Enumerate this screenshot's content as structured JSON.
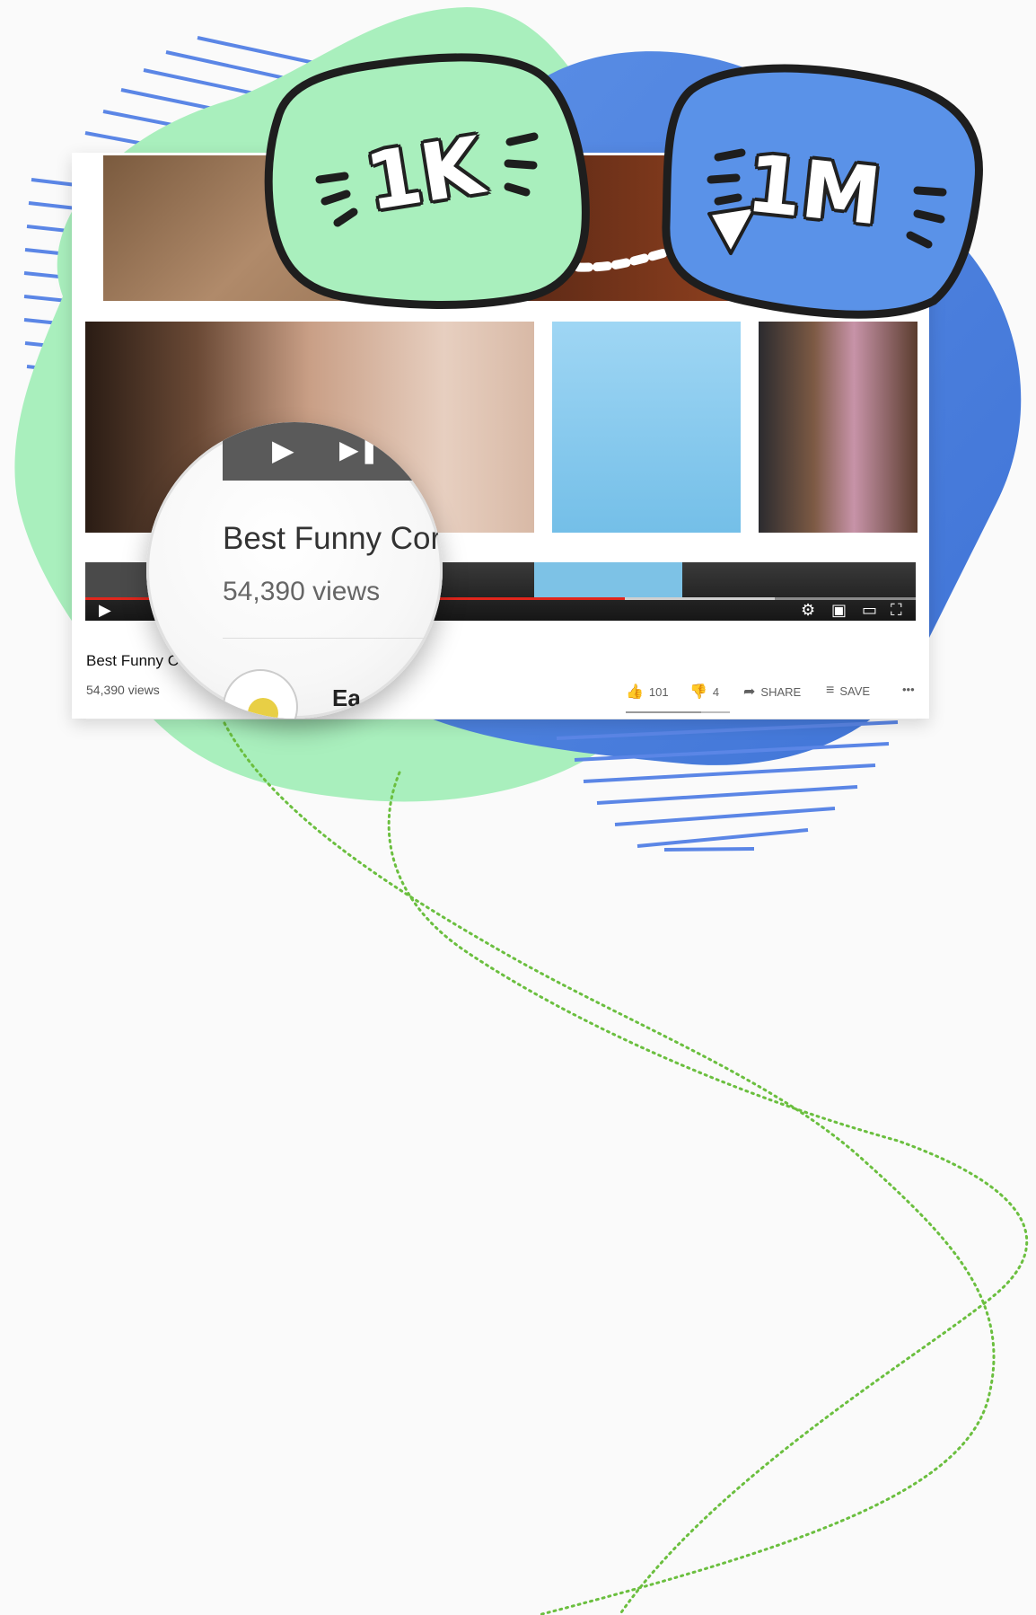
{
  "badges": {
    "from": {
      "label": "1K",
      "color": "#a9efbd"
    },
    "to": {
      "label": "1M",
      "color": "#5a92e8"
    }
  },
  "video": {
    "title": "Best Funny C",
    "views": "54,390 views",
    "progress_percent": 65,
    "buffered_percent": 83,
    "actions": {
      "like_count": "101",
      "dislike_count": "4",
      "share_label": "SHARE",
      "save_label": "SAVE",
      "more_label": "•••"
    },
    "player_controls": {
      "play": "▶",
      "next": "▶|"
    }
  },
  "magnifier": {
    "title": "Best Funny Cor",
    "views": "54,390 views",
    "next_title": "Ea"
  },
  "colors": {
    "accent_green": "#a9efbd",
    "accent_blue": "#5a92e8",
    "stripe_blue": "#5b86e6",
    "dotted_line": "#6bbf3f",
    "progress_red": "#e1261c"
  },
  "icons": [
    "play-icon",
    "next-icon",
    "settings-icon",
    "miniplayer-icon",
    "theater-icon",
    "fullscreen-icon",
    "like-icon",
    "dislike-icon",
    "share-icon",
    "save-icon",
    "more-icon",
    "arrow-icon"
  ]
}
